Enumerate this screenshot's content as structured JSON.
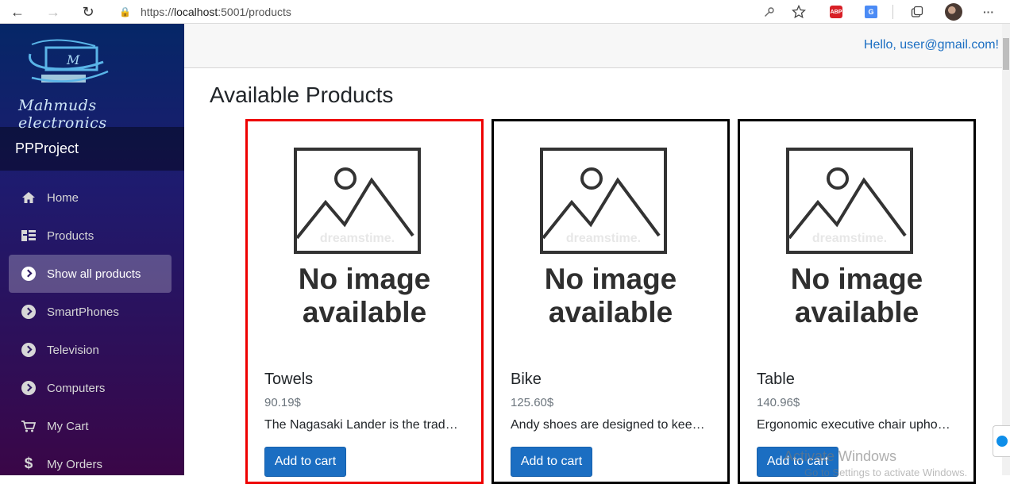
{
  "browser": {
    "back_icon": "←",
    "forward_icon": "→",
    "refresh_icon": "↻",
    "lock_icon": "🔒",
    "url_prefix": "https://",
    "url_host": "localhost",
    "url_rest": ":5001/products",
    "abp_label": "ABP",
    "more_icon": "···"
  },
  "sidebar": {
    "logo_text": "Mahmuds electronics",
    "brand": "PPProject",
    "items": [
      {
        "label": "Home",
        "icon": "home-icon"
      },
      {
        "label": "Products",
        "icon": "list-icon"
      },
      {
        "label": "Show all products",
        "icon": "arrow-circle-icon",
        "active": true
      },
      {
        "label": "SmartPhones",
        "icon": "arrow-circle-icon"
      },
      {
        "label": "Television",
        "icon": "arrow-circle-icon"
      },
      {
        "label": "Computers",
        "icon": "arrow-circle-icon"
      },
      {
        "label": "My Cart",
        "icon": "cart-icon"
      },
      {
        "label": "My Orders",
        "icon": "dollar-icon"
      }
    ]
  },
  "header": {
    "greeting": "Hello, user@gmail.com!"
  },
  "main": {
    "title": "Available Products",
    "placeholder_line1": "No image",
    "placeholder_line2": "available",
    "placeholder_watermark": "dreamstime.",
    "products": [
      {
        "name": "Towels",
        "price": "90.19$",
        "description": "The Nagasaki Lander is the trademarked name of several series of Nagasaki sport bikes",
        "button": "Add to cart"
      },
      {
        "name": "Bike",
        "price": "125.60$",
        "description": "Andy shoes are designed to keeping in mind durability as well as trends",
        "button": "Add to cart"
      },
      {
        "name": "Table",
        "price": "140.96$",
        "description": "Ergonomic executive chair upholstered in bonded black leather and PVC",
        "button": "Add to cart"
      }
    ]
  },
  "overlay": {
    "watermark": "Activate Windows",
    "watermark_sub": "Go to Settings to activate Windows."
  }
}
